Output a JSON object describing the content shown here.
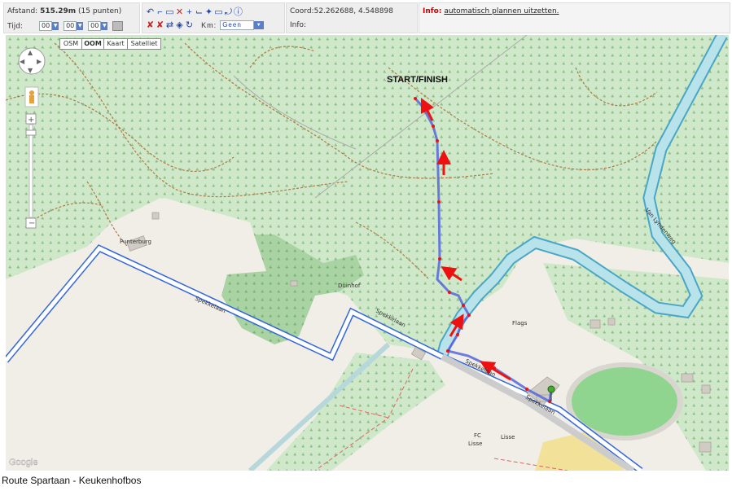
{
  "toolbar": {
    "distance_label": "Afstand:",
    "distance_value": "515.29m",
    "distance_points": "(15 punten)",
    "time_label": "Tijd:",
    "time_h": "00",
    "time_m": "00",
    "time_s": "00",
    "km_label": "Km:",
    "km_value": "Geen",
    "coord_label": "Coord:",
    "coord_value": "52.262688, 4.548898",
    "info_label": "Info:",
    "info_value": "",
    "notice_label": "Info:",
    "notice_link": "automatisch plannen uitzetten."
  },
  "map": {
    "types": [
      "OSM",
      "OOM",
      "Kaart",
      "Satelliet"
    ],
    "labels": {
      "start_finish": "START/FINISH",
      "punterburg": "Punterburg",
      "duinhof": "Duinhof",
      "flags": "Flags",
      "fc": "FC",
      "lisse1": "Lisse",
      "lisse2": "Lisse",
      "spekkelaan1": "Spekkelaan",
      "spekkelaan2": "Spekkelaan",
      "spekkelaan3": "Spekkelaan",
      "spekkelaan4": "Spekkelaan",
      "van_lyndenweg": "Van Lyndenweg",
      "google": "Google"
    },
    "colors": {
      "forest": "#cfe8c9",
      "dark_forest": "#a9d3a3",
      "water": "#b9e3ea",
      "route": "#5566dd",
      "arrow": "#ee1111",
      "road": "#3366dd"
    }
  },
  "caption": "Route Spartaan - Keukenhofbos"
}
